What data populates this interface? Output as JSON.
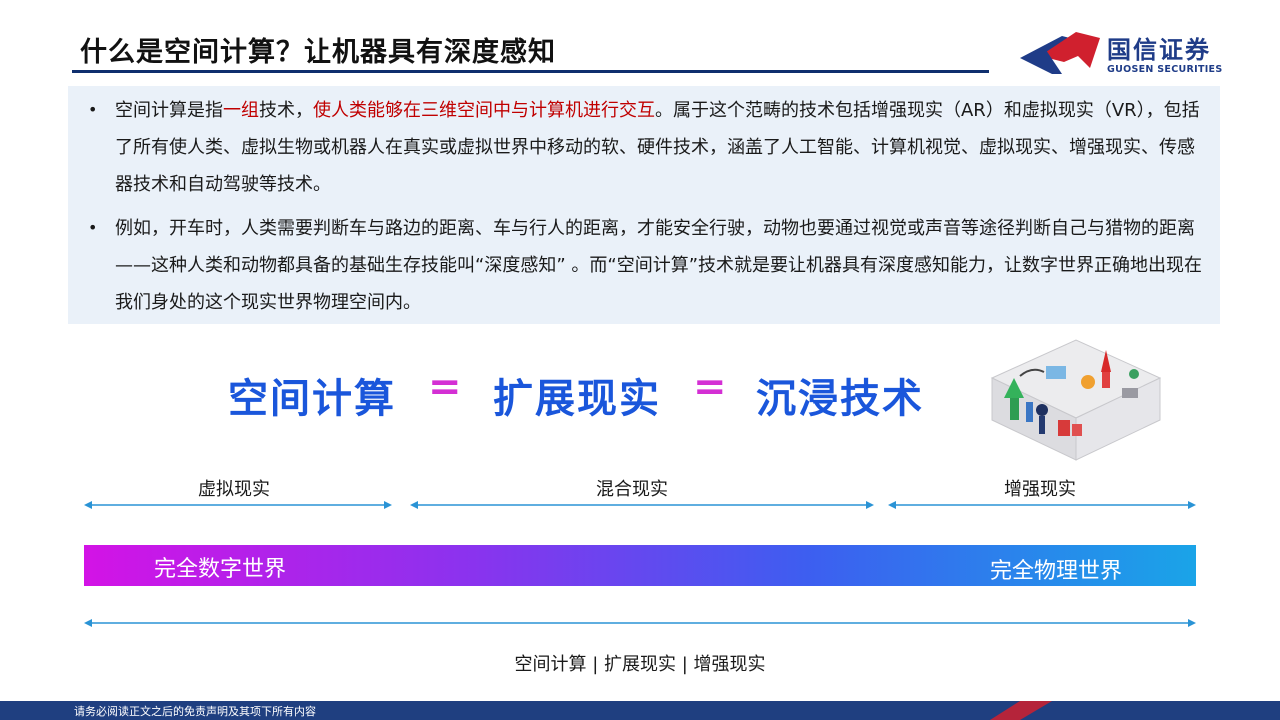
{
  "header": {
    "title": "什么是空间计算？让机器具有深度感知",
    "logo_cn": "国信证券",
    "logo_en": "GUOSEN SECURITIES"
  },
  "bullets": [
    {
      "marker": "•",
      "segments": [
        {
          "text": "空间计算是指",
          "red": false
        },
        {
          "text": "一组",
          "red": true
        },
        {
          "text": "技术，",
          "red": false
        },
        {
          "text": "使人类能够在三维空间中与计算机进行交互",
          "red": true
        },
        {
          "text": "。属于这个范畴的技术包括增强现实（AR）和虚拟现实（VR），包括了所有使人类、虚拟生物或机器人在真实或虚拟世界中移动的软、硬件技术，涵盖了人工智能、计算机视觉、虚拟现实、增强现实、传感器技术和自动驾驶等技术。",
          "red": false
        }
      ]
    },
    {
      "marker": "•",
      "segments": [
        {
          "text": "例如，开车时，人类需要判断车与路边的距离、车与行人的距离，才能安全行驶，动物也要通过视觉或声音等途径判断自己与猎物的距离——这种人类和动物都具备的基础生存技能叫“深度感知” 。而“空间计算”技术就是要让机器具有深度感知能力，让数字世界正确地出现在我们身处的这个现实世界物理空间内。",
          "red": false
        }
      ]
    }
  ],
  "equation": {
    "term1": "空间计算",
    "term2": "扩展现实",
    "term3": "沉浸技术",
    "sign": "="
  },
  "segments": {
    "vr": "虚拟现实",
    "mr": "混合现实",
    "ar": "增强现实"
  },
  "spectrum": {
    "left": "完全数字世界",
    "right": "完全物理世界",
    "colors": [
      "#d313e6",
      "#8a33ee",
      "#3d5ef0",
      "#1aa4e8"
    ]
  },
  "bottom_label": "空间计算 | 扩展现实 | 增强现实",
  "footer": "请务必阅读正文之后的免责声明及其项下所有内容",
  "colors": {
    "accent_blue": "#1a56db",
    "equals_magenta": "#d42fd4",
    "highlight_red": "#c00000",
    "navy": "#1f3f80",
    "arrow": "#2a93d5"
  }
}
